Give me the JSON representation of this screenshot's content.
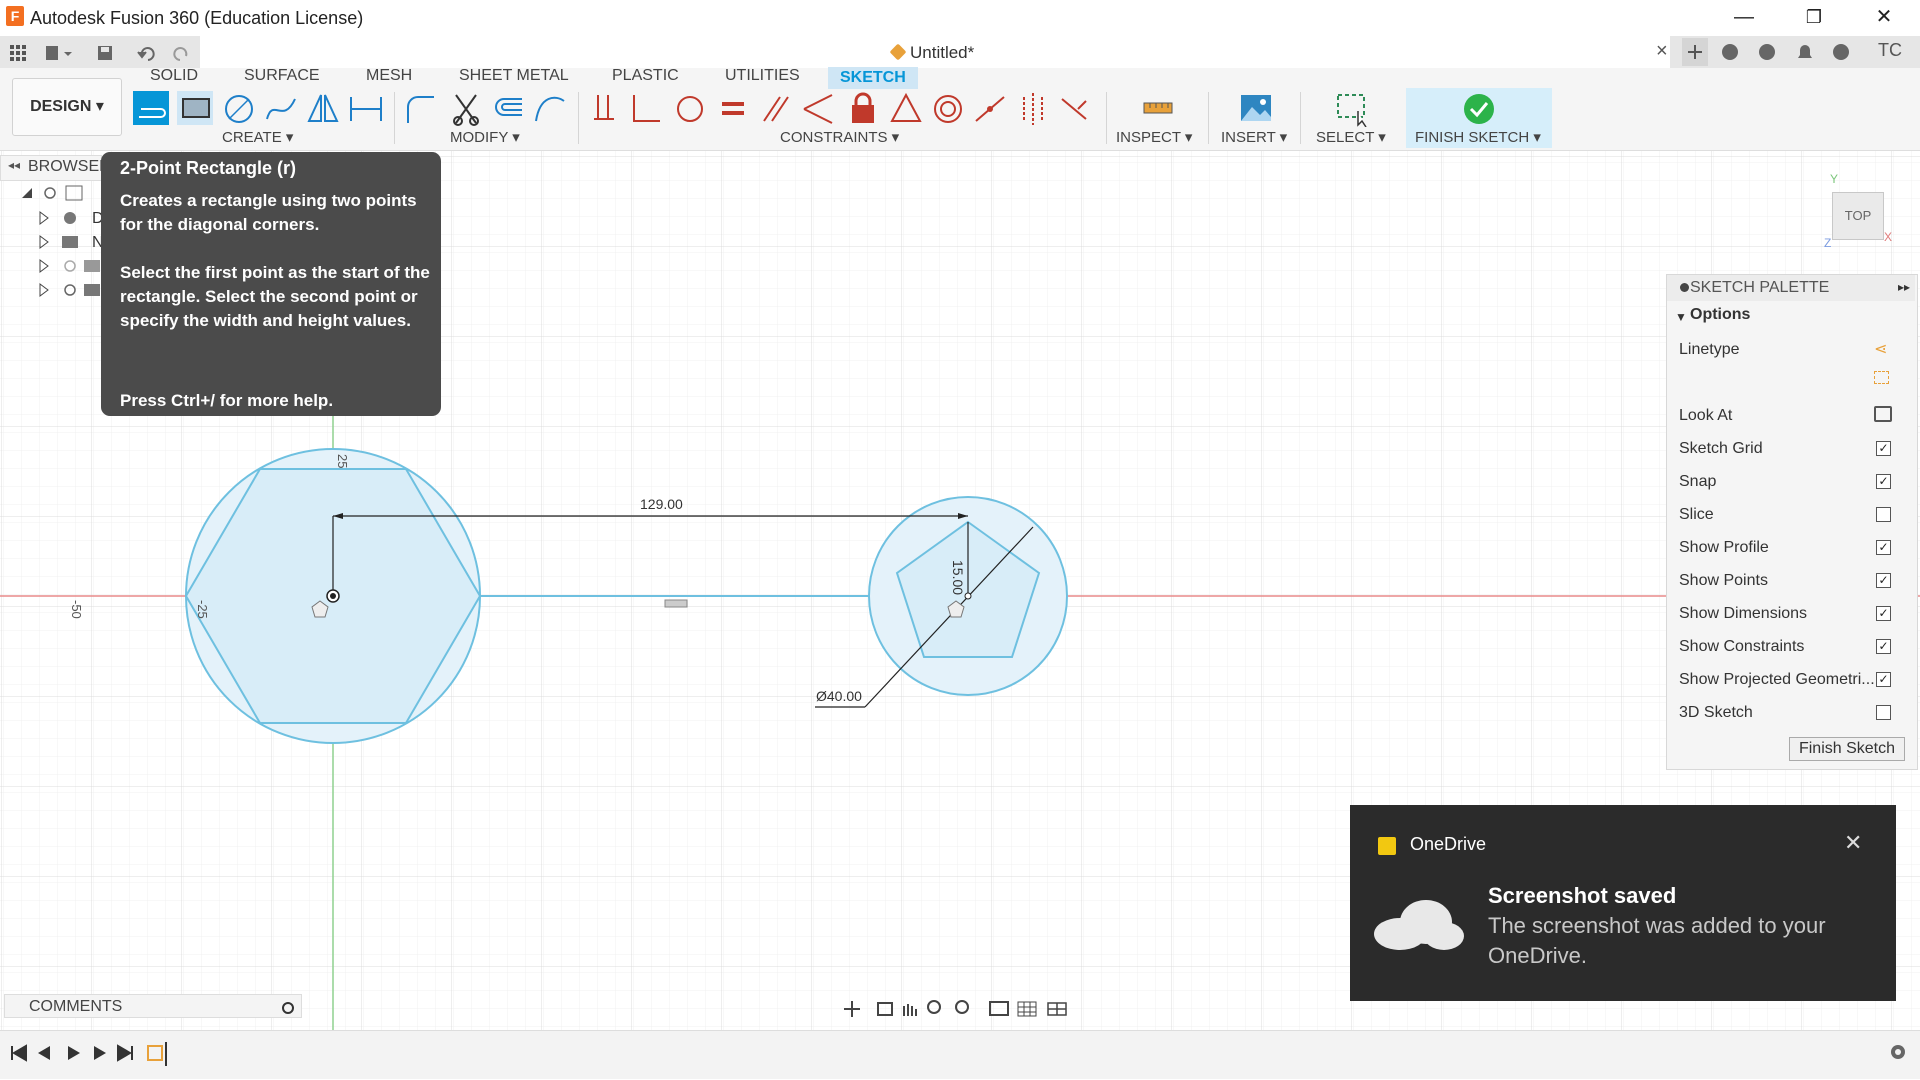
{
  "window": {
    "title": "Autodesk Fusion 360 (Education License)",
    "logo": "F",
    "minimize": "—",
    "restore": "❐",
    "close": "✕"
  },
  "tabs": {
    "doc_title": "Untitled*",
    "close_tab": "×",
    "user_initials": "TC"
  },
  "toolbar": {
    "design_label": "DESIGN ▾",
    "workspace_tabs": [
      "SOLID",
      "SURFACE",
      "MESH",
      "SHEET METAL",
      "PLASTIC",
      "UTILITIES",
      "SKETCH"
    ],
    "active_tab": "SKETCH",
    "groups": {
      "create": "CREATE ▾",
      "modify": "MODIFY ▾",
      "constraints": "CONSTRAINTS ▾",
      "inspect": "INSPECT ▾",
      "insert": "INSERT ▾",
      "select": "SELECT ▾",
      "finish": "FINISH SKETCH ▾"
    }
  },
  "browser": {
    "header": "BROWSER",
    "items": [
      "D",
      "N"
    ]
  },
  "tooltip": {
    "title": "2-Point Rectangle (r)",
    "line1": "Creates a rectangle using two points for the diagonal corners.",
    "line2": "Select the first point as the start of the rectangle. Select the second point or specify the width and height values.",
    "line3": "Press Ctrl+/ for more help."
  },
  "sketch": {
    "dim_distance": "129.00",
    "dim_vertical": "15.00",
    "dim_diameter": "Ø40.00",
    "axis_labels": [
      "25",
      "-25",
      "-50"
    ]
  },
  "viewcube": {
    "face": "TOP",
    "axis_y": "Y",
    "axis_x": "X",
    "axis_z": "Z"
  },
  "palette": {
    "title": "SKETCH PALETTE",
    "options_label": "Options",
    "rows": [
      {
        "label": "Linetype",
        "checked": null
      },
      {
        "label": "",
        "checked": null
      },
      {
        "label": "Look At",
        "checked": null
      },
      {
        "label": "Sketch Grid",
        "checked": true
      },
      {
        "label": "Snap",
        "checked": true
      },
      {
        "label": "Slice",
        "checked": false
      },
      {
        "label": "Show Profile",
        "checked": true
      },
      {
        "label": "Show Points",
        "checked": true
      },
      {
        "label": "Show Dimensions",
        "checked": true
      },
      {
        "label": "Show Constraints",
        "checked": true
      },
      {
        "label": "Show Projected Geometri...",
        "checked": true
      },
      {
        "label": "3D Sketch",
        "checked": false
      }
    ],
    "finish_button": "Finish Sketch"
  },
  "toast": {
    "app": "OneDrive",
    "heading": "Screenshot saved",
    "body": "The screenshot was added to your OneDrive.",
    "close": "✕"
  },
  "bottom": {
    "comments": "COMMENTS"
  },
  "colors": {
    "accent": "#0696d7",
    "sketch_line": "#6ec0e0",
    "profile_fill": "#dff0f9",
    "x_axis": "#e88a8a",
    "y_axis": "#8fd18f"
  }
}
